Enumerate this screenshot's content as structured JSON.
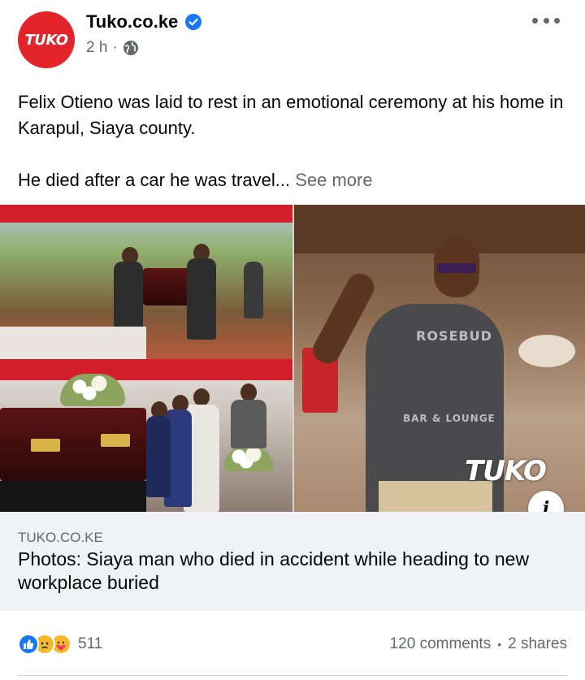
{
  "post": {
    "page_name": "Tuko.co.ke",
    "logo_text": "TUKO",
    "time": "2 h",
    "separator": "·",
    "text_line1": "Felix Otieno was laid to rest in an emotional ceremony at his home in Karapul, Siaya county.",
    "text_line2": "He died after a car he was travel...",
    "see_more": "See more"
  },
  "media": {
    "shirt_text": "ROSEBUD",
    "shirt_text2": "BAR & LOUNGE",
    "watermark": "TUKO",
    "info_label": "i"
  },
  "link": {
    "domain": "TUKO.CO.KE",
    "title": "Photos: Siaya man who died in accident while heading to new workplace buried"
  },
  "engagement": {
    "reactions_count": "511",
    "comments": "120 comments",
    "bullet": "•",
    "shares": "2 shares"
  },
  "icons": {
    "verified": "verified-badge-icon",
    "audience": "globe-icon",
    "menu": "more-options-icon",
    "reactions": [
      "like-icon",
      "sad-icon",
      "care-icon"
    ]
  },
  "colors": {
    "brand": "#e3242b",
    "verified": "#1877f2",
    "secondary_text": "#65676b",
    "link_bg": "#f0f2f5"
  }
}
